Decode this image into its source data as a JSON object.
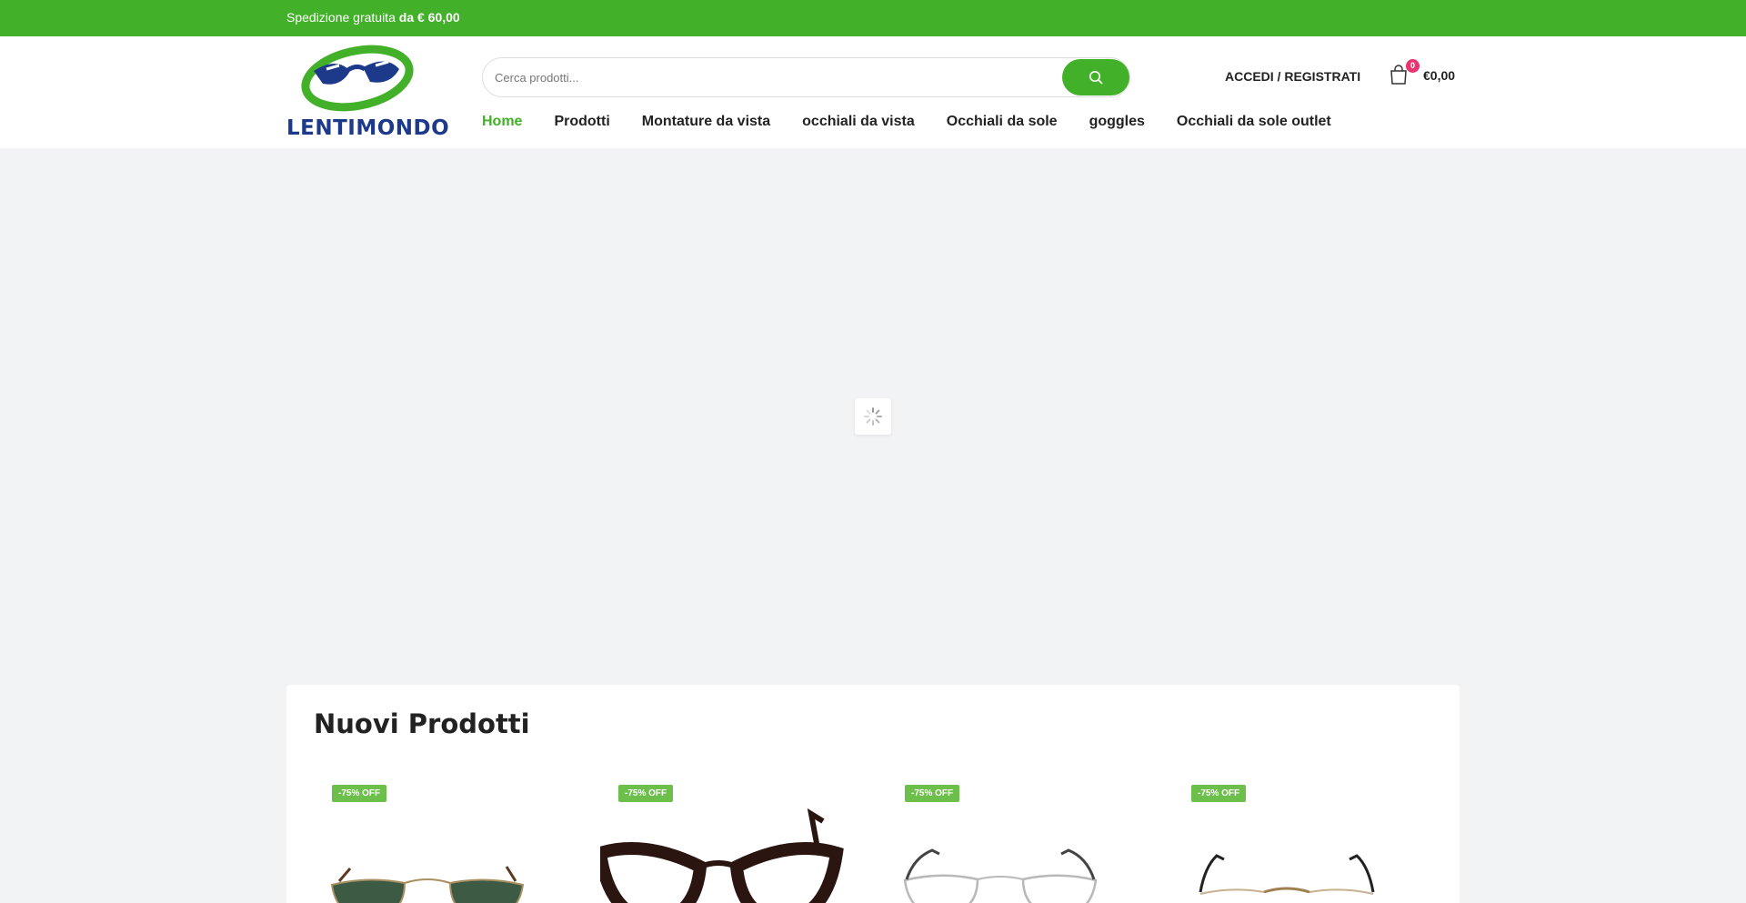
{
  "topbar": {
    "text": "Spedizione gratuita ",
    "bold": "da € 60,00"
  },
  "header": {
    "logo_text": "LENTIMONDO",
    "search_placeholder": "Cerca prodotti...",
    "login_label": "ACCEDI / REGISTRATI",
    "cart_count": "0",
    "cart_total": "€0,00",
    "icons": {
      "search": "search-icon",
      "cart": "shopping-bag-icon"
    }
  },
  "nav": {
    "items": [
      {
        "label": "Home",
        "active": true
      },
      {
        "label": "Prodotti"
      },
      {
        "label": "Montature da vista"
      },
      {
        "label": "occhiali da vista"
      },
      {
        "label": "Occhiali da sole"
      },
      {
        "label": "goggles"
      },
      {
        "label": "Occhiali da sole outlet"
      }
    ]
  },
  "section": {
    "title": "Nuovi Prodotti",
    "products": [
      {
        "badge": "-75% OFF"
      },
      {
        "badge": "-75% OFF"
      },
      {
        "badge": "-75% OFF"
      },
      {
        "badge": "-75% OFF"
      }
    ]
  },
  "colors": {
    "accent": "#43b02a",
    "brand_blue": "#1d3a8a",
    "badge": "#e8346f"
  }
}
